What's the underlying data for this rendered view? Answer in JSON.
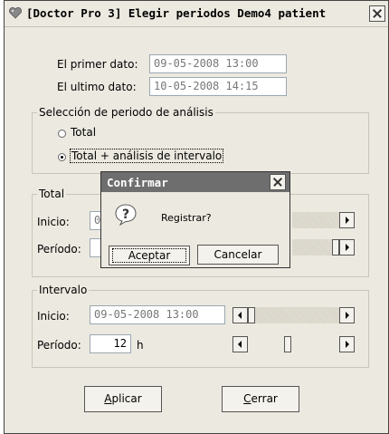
{
  "window": {
    "title": "[Doctor Pro 3] Elegir periodos  Demo4 patient"
  },
  "dates": {
    "first_label": "El primer dato:",
    "first_value": "09-05-2008 13:00",
    "last_label": "El ultimo dato:",
    "last_value": "10-05-2008 14:15"
  },
  "analysis_group": {
    "legend": "Selección de periodo de análisis",
    "option_total": "Total",
    "option_total_interval": "Total + análisis de intervalo",
    "selected": "Total + análisis de intervalo"
  },
  "total_group": {
    "legend": "Total",
    "inicio_label": "Inicio:",
    "inicio_partial": "0",
    "periodo_label": "Período:"
  },
  "interval_group": {
    "legend": "Intervalo",
    "inicio_label": "Inicio:",
    "inicio_value": "09-05-2008 13:00",
    "periodo_label": "Período:",
    "periodo_value": "12",
    "periodo_unit": "h"
  },
  "buttons": {
    "apply_prefix": "",
    "apply_key": "A",
    "apply_rest": "plicar",
    "close_key": "C",
    "close_rest": "errar"
  },
  "confirm_dialog": {
    "title": "Confirmar",
    "message": "Registrar?",
    "icon": "question-icon",
    "ok": "Aceptar",
    "cancel": "Cancelar"
  }
}
